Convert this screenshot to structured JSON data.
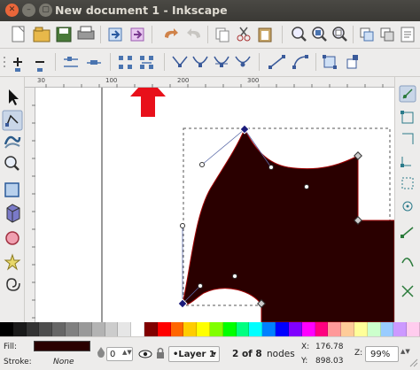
{
  "window": {
    "title": "New document 1 - Inkscape",
    "close_glyph": "✕",
    "minimize_glyph": "–",
    "maximize_glyph": "▢"
  },
  "ruler": {
    "ticks": [
      "30",
      "100",
      "200",
      "300"
    ]
  },
  "statusbar": {
    "fill_label": "Fill:",
    "stroke_label": "Stroke:",
    "stroke_value": "None",
    "fill_color": "#2a0000",
    "opacity_value": "0",
    "layer_name": "•Layer 1",
    "node_count": "2 of 8",
    "node_suffix": "nodes",
    "x_label": "X:",
    "x_value": "176.78",
    "y_label": "Y:",
    "y_value": "898.03",
    "zoom_label": "Z:",
    "zoom_value": "99%"
  },
  "colors": {
    "shape_fill": "#2a0000",
    "shape_stroke": "#a00000",
    "annotation_arrow": "#e8101a",
    "selected_node": "#1a1a7a",
    "handle_line": "#5a6aa8"
  },
  "palette": [
    "#000000",
    "#1a1a1a",
    "#333333",
    "#4d4d4d",
    "#666666",
    "#808080",
    "#999999",
    "#b3b3b3",
    "#cccccc",
    "#e6e6e6",
    "#ffffff",
    "#800000",
    "#ff0000",
    "#ff6600",
    "#ffcc00",
    "#ffff00",
    "#80ff00",
    "#00ff00",
    "#00ff80",
    "#00ffff",
    "#0080ff",
    "#0000ff",
    "#8000ff",
    "#ff00ff",
    "#ff0080",
    "#ff9999",
    "#ffcc99",
    "#ffff99",
    "#ccffcc",
    "#99ccff",
    "#cc99ff",
    "#ffccee"
  ]
}
